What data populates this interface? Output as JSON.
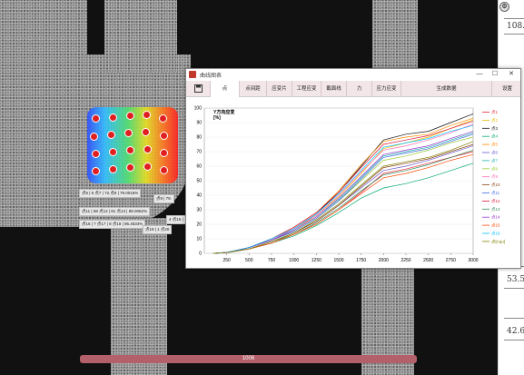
{
  "window": {
    "title": "曲线图表",
    "min_icon": "minimize-icon",
    "max_icon": "maximize-icon",
    "close_icon": "close-icon",
    "min_glyph": "—",
    "max_glyph": "☐",
    "close_glyph": "✕"
  },
  "toolbar": {
    "save_icon": "save-icon",
    "tabs": [
      {
        "label": "点"
      },
      {
        "label": "点间距"
      },
      {
        "label": "应变片"
      },
      {
        "label": "工程应变"
      },
      {
        "label": "截面线"
      },
      {
        "label": "力"
      },
      {
        "label": "应力应变"
      },
      {
        "label": "生成数据"
      },
      {
        "label": "设置"
      }
    ]
  },
  "ruler": {
    "icon": "gear-icon",
    "values": [
      "108.",
      "53.5",
      "42.6"
    ]
  },
  "progress": {
    "label": "1006",
    "fraction": 1.0
  },
  "overlay": {
    "callouts": [
      "点5 | 5 点7 | 72.点8 | 79.0016%",
      "点9 | 79.",
      "点11 | 58 点12 | 81 点13 | 88.0062%",
      "4 点15 |",
      "点16 | 7 点17 | 8 点18 | 95.4534%",
      "点19 | 1 点20"
    ]
  },
  "chart_data": {
    "type": "line",
    "title": "Y方向应变",
    "ylabel": "[%]",
    "xlim": [
      0,
      3000
    ],
    "ylim": [
      0,
      100
    ],
    "xticks": [
      250,
      500,
      750,
      1000,
      1250,
      1500,
      1750,
      2000,
      2250,
      2500,
      2750,
      3000
    ],
    "yticks": [
      0,
      10,
      20,
      30,
      40,
      50,
      60,
      70,
      80,
      90,
      100
    ],
    "x": [
      100,
      250,
      500,
      750,
      1000,
      1250,
      1500,
      1750,
      2000,
      2250,
      2500,
      2750,
      3000
    ],
    "series": [
      {
        "name": "点1",
        "color": "#e32636",
        "values": [
          0,
          0.5,
          3,
          7,
          13,
          20,
          30,
          42,
          55,
          58,
          62,
          66,
          70
        ]
      },
      {
        "name": "点2",
        "color": "#e6b800",
        "values": [
          0,
          0.6,
          4,
          9,
          16,
          26,
          39,
          55,
          72,
          76,
          80,
          86,
          92
        ]
      },
      {
        "name": "点3",
        "color": "#111111",
        "values": [
          0,
          0.6,
          4,
          9,
          17,
          27,
          42,
          60,
          78,
          82,
          84,
          90,
          96
        ]
      },
      {
        "name": "点4",
        "color": "#00a86b",
        "values": [
          0,
          0.5,
          3,
          7,
          12,
          19,
          28,
          38,
          45,
          48,
          52,
          57,
          62
        ]
      },
      {
        "name": "点5",
        "color": "#ff8c00",
        "values": [
          0,
          0.6,
          4,
          10,
          18,
          28,
          43,
          61,
          77,
          80,
          82,
          88,
          93
        ]
      },
      {
        "name": "点6",
        "color": "#6a5acd",
        "values": [
          0,
          0.5,
          3,
          8,
          14,
          22,
          33,
          45,
          57,
          60,
          64,
          69,
          74
        ]
      },
      {
        "name": "点7",
        "color": "#20b2aa",
        "values": [
          0,
          0.6,
          4,
          9,
          16,
          25,
          37,
          52,
          67,
          70,
          73,
          78,
          83
        ]
      },
      {
        "name": "点8",
        "color": "#9acd32",
        "values": [
          0,
          0.5,
          4,
          9,
          15,
          24,
          36,
          50,
          64,
          67,
          71,
          76,
          80
        ]
      },
      {
        "name": "点9",
        "color": "#ff69b4",
        "values": [
          0,
          0.6,
          4,
          9,
          17,
          26,
          40,
          56,
          71,
          74,
          78,
          83,
          89
        ]
      },
      {
        "name": "点10",
        "color": "#8b4513",
        "values": [
          0,
          0.5,
          3,
          8,
          14,
          22,
          33,
          46,
          59,
          62,
          65,
          70,
          75
        ]
      },
      {
        "name": "点11",
        "color": "#4169e1",
        "values": [
          0,
          0.5,
          4,
          9,
          15,
          24,
          36,
          51,
          66,
          69,
          72,
          77,
          82
        ]
      },
      {
        "name": "点12",
        "color": "#dc143c",
        "values": [
          0,
          0.6,
          4,
          10,
          18,
          28,
          42,
          59,
          75,
          78,
          81,
          86,
          91
        ]
      },
      {
        "name": "点13",
        "color": "#2e8b57",
        "values": [
          0,
          0.5,
          3,
          8,
          13,
          21,
          31,
          43,
          54,
          57,
          61,
          66,
          71
        ]
      },
      {
        "name": "点14",
        "color": "#9932cc",
        "values": [
          0,
          0.5,
          4,
          9,
          16,
          25,
          38,
          53,
          68,
          71,
          74,
          79,
          84
        ]
      },
      {
        "name": "点15",
        "color": "#ff4500",
        "values": [
          0,
          0.5,
          3,
          7,
          13,
          20,
          30,
          41,
          52,
          55,
          59,
          64,
          68
        ]
      },
      {
        "name": "点16",
        "color": "#00bfff",
        "values": [
          0,
          0.6,
          4,
          10,
          17,
          27,
          41,
          57,
          73,
          76,
          79,
          84,
          88
        ]
      },
      {
        "name": "点[Aqu]",
        "color": "#808000",
        "values": [
          0,
          0.5,
          3,
          8,
          14,
          23,
          34,
          47,
          60,
          63,
          66,
          71,
          77
        ]
      }
    ]
  }
}
